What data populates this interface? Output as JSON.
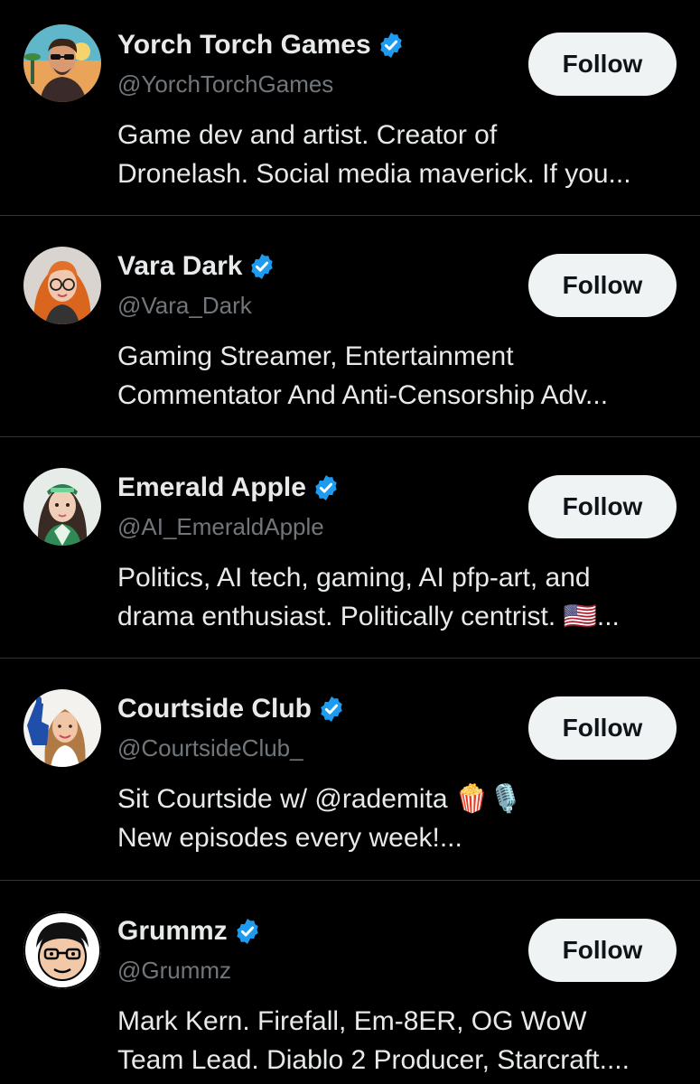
{
  "accent": "#1d9bf0",
  "follow_label": "Follow",
  "accounts": [
    {
      "name": "Yorch Torch Games",
      "handle": "@YorchTorchGames",
      "verified": true,
      "avatar_icon": "avatar-man-sunglasses",
      "bio_lines": [
        "Game dev and artist. Creator of",
        "Dronelash. Social media maverick. If you..."
      ]
    },
    {
      "name": "Vara Dark",
      "handle": "@Vara_Dark",
      "verified": true,
      "avatar_icon": "avatar-redhead-glasses",
      "bio_lines": [
        "Gaming Streamer, Entertainment",
        "Commentator And Anti-Censorship Adv..."
      ]
    },
    {
      "name": "Emerald Apple",
      "handle": "@AI_EmeraldApple",
      "verified": true,
      "avatar_icon": "avatar-woman-green",
      "bio_lines": [
        "Politics, AI tech, gaming, AI pfp-art, and",
        "drama enthusiast. Politically centrist. 🇺🇸..."
      ]
    },
    {
      "name": "Courtside Club",
      "handle": "@CourtsideClub_",
      "verified": true,
      "avatar_icon": "avatar-woman-foam-finger",
      "bio_lines": [
        "Sit Courtside w/ @rademita 🍿🎙️",
        "New episodes every week!..."
      ]
    },
    {
      "name": "Grummz",
      "handle": "@Grummz",
      "verified": true,
      "avatar_icon": "avatar-cartoon-glasses",
      "bio_lines": [
        "Mark Kern. Firefall, Em-8ER, OG WoW",
        "Team Lead. Diablo 2 Producer, Starcraft...."
      ]
    }
  ]
}
